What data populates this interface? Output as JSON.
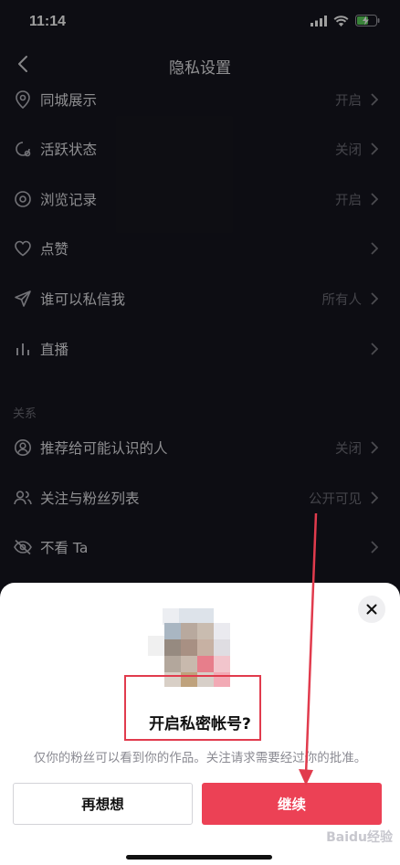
{
  "status_bar": {
    "time": "11:14"
  },
  "header": {
    "title": "隐私设置"
  },
  "settings": [
    {
      "icon": "location-pin-icon",
      "label": "同城展示",
      "value": "开启"
    },
    {
      "icon": "activity-status-icon",
      "label": "活跃状态",
      "value": "关闭"
    },
    {
      "icon": "eye-icon",
      "label": "浏览记录",
      "value": "开启"
    },
    {
      "icon": "heart-icon",
      "label": "点赞",
      "value": ""
    },
    {
      "icon": "paper-plane-icon",
      "label": "谁可以私信我",
      "value": "所有人"
    },
    {
      "icon": "bar-chart-icon",
      "label": "直播",
      "value": ""
    }
  ],
  "relations_section": {
    "header": "关系",
    "items": [
      {
        "icon": "person-circle-icon",
        "label": "推荐给可能认识的人",
        "value": "关闭"
      },
      {
        "icon": "people-icon",
        "label": "关注与粉丝列表",
        "value": "公开可见"
      },
      {
        "icon": "eye-slash-icon",
        "label": "不看 Ta",
        "value": ""
      }
    ]
  },
  "dialog": {
    "title": "开启私密帐号?",
    "description": "仅你的粉丝可以看到你的作品。关注请求需要经过你的批准。",
    "cancel_label": "再想想",
    "confirm_label": "继续"
  },
  "watermark": "Baidu经验",
  "colors": {
    "accent": "#ec4155",
    "background": "#16161f",
    "annotation": "#e13b4d"
  }
}
